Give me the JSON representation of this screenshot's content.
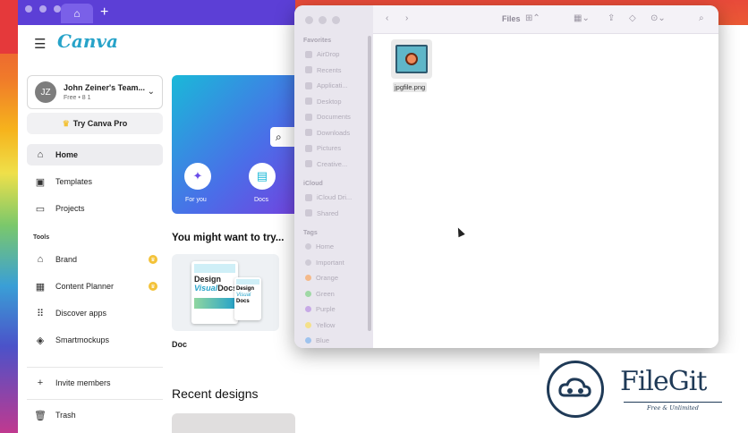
{
  "browser": {
    "new_tab_icon": "plus-icon",
    "home_tab_icon": "home-icon"
  },
  "canva": {
    "logo": "Canva",
    "team": {
      "initials": "JZ",
      "name": "John Zeiner's Team...",
      "sub": "Free • 8 1"
    },
    "try_pro": "Try Canva Pro",
    "nav": [
      {
        "label": "Home",
        "icon": "home-icon"
      },
      {
        "label": "Templates",
        "icon": "templates-icon"
      },
      {
        "label": "Projects",
        "icon": "folder-icon"
      }
    ],
    "tools_heading": "Tools",
    "tools": [
      {
        "label": "Brand",
        "icon": "brand-icon"
      },
      {
        "label": "Content Planner",
        "icon": "calendar-icon"
      },
      {
        "label": "Discover apps",
        "icon": "apps-icon"
      },
      {
        "label": "Smartmockups",
        "icon": "layers-icon"
      }
    ],
    "invite": "Invite members",
    "trash": "Trash",
    "hero_shortcuts": [
      {
        "label": "For you",
        "glyph": "✦"
      },
      {
        "label": "Docs",
        "glyph": "▤"
      }
    ],
    "suggest_heading": "You might want to try...",
    "card": {
      "label": "Doc",
      "doc_title_1": "Design",
      "doc_title_2": "Visual",
      "doc_title_3": "Docs"
    },
    "recent_heading": "Recent designs"
  },
  "finder": {
    "title": "Files",
    "sections": [
      {
        "heading": "Favorites",
        "items": [
          "AirDrop",
          "Recents",
          "Applicati...",
          "Desktop",
          "Documents",
          "Downloads",
          "Pictures",
          "Creative..."
        ]
      },
      {
        "heading": "iCloud",
        "items": [
          "iCloud Dri...",
          "Shared"
        ]
      },
      {
        "heading": "Tags",
        "items": [
          "Home",
          "Important",
          "Orange",
          "Green",
          "Purple",
          "Yellow",
          "Blue"
        ]
      }
    ],
    "tag_colors": [
      "#cfcbd6",
      "#cfcbd6",
      "#f4b98a",
      "#9fd8a5",
      "#c7a9e6",
      "#f4e08a",
      "#9fc3ee"
    ],
    "file": {
      "name": "jpgfile.png"
    }
  },
  "watermark": {
    "name": "FileGit",
    "tagline": "Free & Unlimited"
  }
}
